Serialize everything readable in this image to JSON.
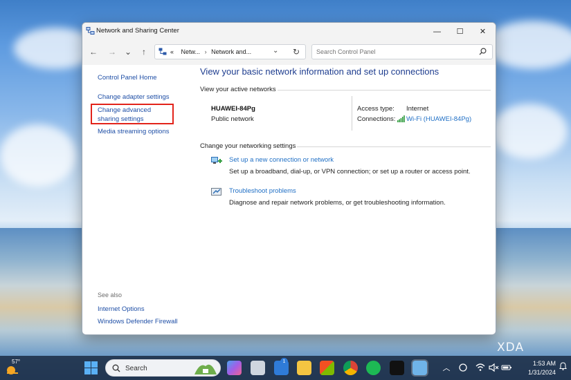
{
  "window": {
    "title": "Network and Sharing Center",
    "controls": {
      "minimize": "—",
      "maximize": "☐",
      "close": "✕"
    }
  },
  "navigation": {
    "back": "←",
    "forward": "→",
    "recent": "⌄",
    "up": "↑",
    "breadcrumb_overflow": "«",
    "crumb_1": "Netw...",
    "crumb_sep": "›",
    "crumb_2": "Network and...",
    "dropdown": "⌄",
    "refresh": "↻",
    "search_placeholder": "Search Control Panel"
  },
  "sidebar": {
    "home": "Control Panel Home",
    "items": [
      "Change adapter settings",
      "Change advanced sharing settings",
      "Media streaming options"
    ],
    "see_also_label": "See also",
    "see_also": [
      "Internet Options",
      "Windows Defender Firewall"
    ]
  },
  "main": {
    "title": "View your basic network information and set up connections",
    "active_networks_label": "View your active networks",
    "network": {
      "name": "HUAWEI-84Pg",
      "type": "Public network",
      "access_type_label": "Access type:",
      "access_type_value": "Internet",
      "connections_label": "Connections:",
      "connections_value": "Wi-Fi (HUAWEI-84Pg)"
    },
    "change_settings_label": "Change your networking settings",
    "tasks": [
      {
        "link": "Set up a new connection or network",
        "desc": "Set up a broadband, dial-up, or VPN connection; or set up a router or access point."
      },
      {
        "link": "Troubleshoot problems",
        "desc": "Diagnose and repair network problems, or get troubleshooting information."
      }
    ]
  },
  "taskbar": {
    "weather_temp": "57°",
    "search_text": "Search",
    "mail_badge": "1",
    "tray": {
      "chevron": "︿",
      "wifi": "wifi",
      "mute": "🔇",
      "battery": "battery"
    },
    "time": "1:53 AM",
    "date": "1/31/2024"
  },
  "watermark": "XDA",
  "colors": {
    "link": "#1f4fa6",
    "title": "#1e3d8f",
    "highlight": "#e2231a"
  }
}
